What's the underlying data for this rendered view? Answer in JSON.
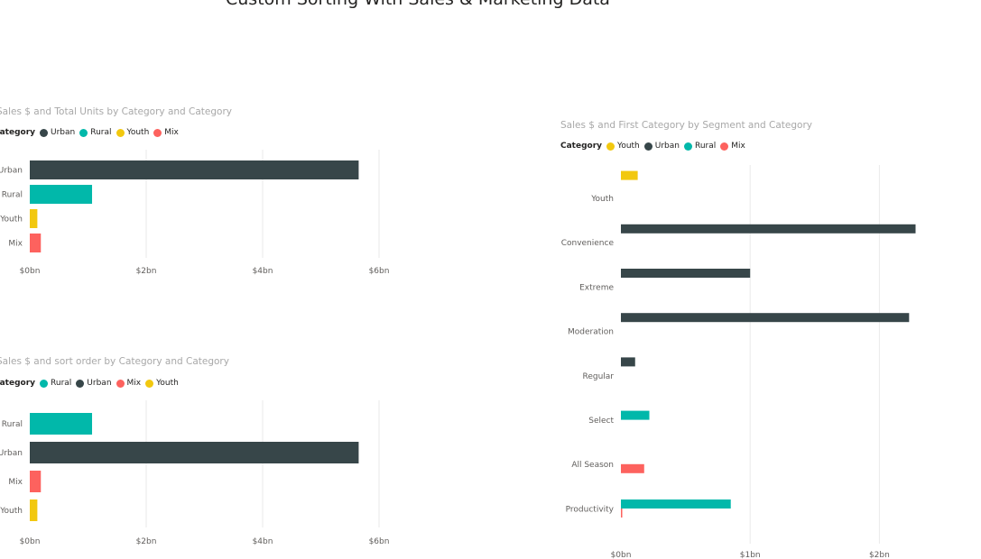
{
  "page": {
    "title": "Custom Sorting With Sales & Marketing Data"
  },
  "colors": {
    "Urban": "#374649",
    "Rural": "#01B8AA",
    "Youth": "#F2C80F",
    "Mix": "#FD625E",
    "grid": "#EAEAEA"
  },
  "chart_data": [
    {
      "id": "chart1",
      "type": "bar",
      "orientation": "horizontal",
      "title": "Sales $ and Total Units by Category and Category",
      "legend_title": "Category",
      "legend": [
        "Urban",
        "Rural",
        "Youth",
        "Mix"
      ],
      "legend_position": "top-left",
      "categories": [
        "Urban",
        "Rural",
        "Youth",
        "Mix"
      ],
      "values": [
        5.65,
        1.07,
        0.13,
        0.19
      ],
      "series_colors": [
        "Urban",
        "Rural",
        "Youth",
        "Mix"
      ],
      "xlim": [
        0,
        6
      ],
      "xticks": [
        0,
        2,
        4,
        6
      ],
      "xtick_labels": [
        "$0bn",
        "$2bn",
        "$4bn",
        "$6bn"
      ],
      "grid": true
    },
    {
      "id": "chart2",
      "type": "bar",
      "orientation": "horizontal",
      "title": "Sales $ and sort order by Category and Category",
      "legend_title": "Category",
      "legend": [
        "Rural",
        "Urban",
        "Mix",
        "Youth"
      ],
      "legend_position": "top-left",
      "categories": [
        "Rural",
        "Urban",
        "Mix",
        "Youth"
      ],
      "values": [
        1.07,
        5.65,
        0.19,
        0.13
      ],
      "series_colors": [
        "Rural",
        "Urban",
        "Mix",
        "Youth"
      ],
      "xlim": [
        0,
        6
      ],
      "xticks": [
        0,
        2,
        4,
        6
      ],
      "xtick_labels": [
        "$0bn",
        "$2bn",
        "$4bn",
        "$6bn"
      ],
      "grid": true
    },
    {
      "id": "chart3",
      "type": "bar",
      "orientation": "horizontal",
      "title": "Sales $ and First Category by Segment and Category",
      "legend_title": "Category",
      "legend": [
        "Youth",
        "Urban",
        "Rural",
        "Mix"
      ],
      "legend_position": "top-left",
      "categories": [
        "Youth",
        "Convenience",
        "Extreme",
        "Moderation",
        "Regular",
        "Select",
        "All Season",
        "Productivity"
      ],
      "series": [
        {
          "name": "Youth",
          "values": [
            0.13,
            0,
            0,
            0,
            0,
            0,
            0,
            0
          ]
        },
        {
          "name": "Urban",
          "values": [
            0,
            2.28,
            1.0,
            2.23,
            0.11,
            0,
            0,
            0
          ]
        },
        {
          "name": "Rural",
          "values": [
            0,
            0,
            0,
            0,
            0,
            0.22,
            0,
            0.85
          ]
        },
        {
          "name": "Mix",
          "values": [
            0,
            0,
            0,
            0,
            0,
            0,
            0.18,
            0.01
          ]
        }
      ],
      "xlim": [
        0,
        2.5
      ],
      "xticks": [
        0,
        1,
        2
      ],
      "xtick_labels": [
        "$0bn",
        "$1bn",
        "$2bn"
      ],
      "grid": true
    }
  ]
}
